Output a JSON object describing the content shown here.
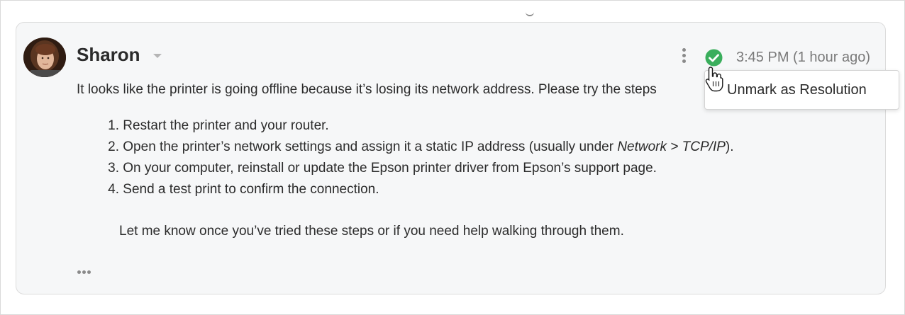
{
  "post": {
    "author": "Sharon",
    "timestamp": "3:45 PM (1 hour ago)",
    "intro": "It looks like the printer is going offline because it’s losing its network address. Please try the steps",
    "steps": [
      {
        "num": "1.",
        "text": "Restart the printer and your router."
      },
      {
        "num": "2.",
        "text_before": "Open the printer’s network settings and assign it a static IP address (usually under ",
        "emphasis": "Network > TCP/IP",
        "text_after": ")."
      },
      {
        "num": "3.",
        "text": "On your computer, reinstall or update the Epson printer driver from Epson’s support page."
      },
      {
        "num": "4.",
        "text": "Send a test print to confirm the connection."
      }
    ],
    "closing": "Let me know once you’ve tried these steps or if you need help walking through them.",
    "resolved_color": "#3aae5c"
  },
  "menu": {
    "unmark_label": "Unmark as Resolution"
  },
  "icons": {
    "avatar": "avatar",
    "more": "vertical-dots-icon",
    "resolved": "check-circle-icon",
    "expand": "horizontal-ellipsis-icon",
    "cursor": "hand-pointer-icon"
  }
}
